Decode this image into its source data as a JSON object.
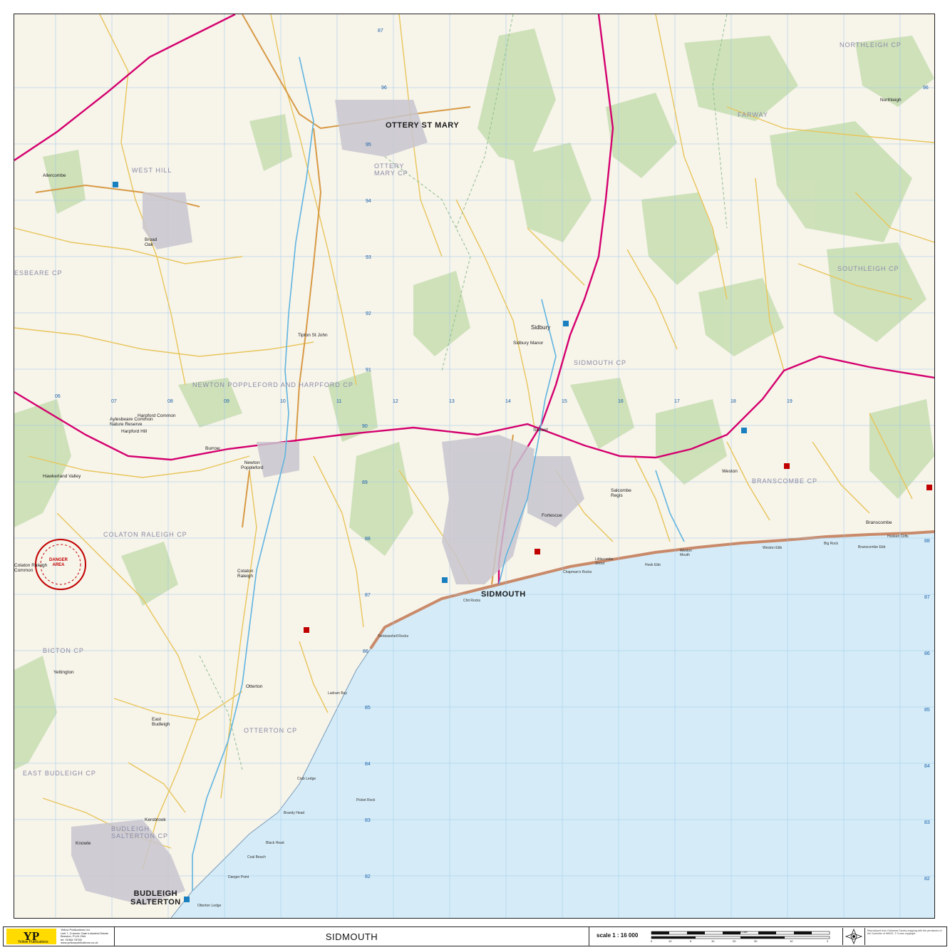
{
  "map": {
    "title": "SIDMOUTH",
    "scale": "scale  1 : 16 000",
    "colors": {
      "sea": "#d5ecf8",
      "land": "#f7f4ea",
      "woodland": "#c9dfb4",
      "a_road": "#d4006e",
      "b_road": "#e8b77a",
      "minor_road": "#f5e06a",
      "river": "#5fb4e0",
      "cliff": "#c98a6a",
      "grid": "#7fb5e0",
      "danger": "#c00000"
    },
    "towns": [
      {
        "id": "sidmouth",
        "name": "SIDMOUTH"
      },
      {
        "id": "ottery",
        "name": "OTTERY ST MARY"
      },
      {
        "id": "budleigh",
        "name": "BUDLEIGH\nSALTERTON"
      }
    ],
    "villages": [
      {
        "id": "sidbury",
        "name": "Sidbury"
      },
      {
        "id": "sidford",
        "name": "Sidford"
      },
      {
        "id": "newton",
        "name": "Newton\nPoppleford"
      },
      {
        "id": "colaton",
        "name": "Colaton\nRaleigh"
      },
      {
        "id": "otterton",
        "name": "Otterton"
      },
      {
        "id": "east-budleigh",
        "name": "East\nBudleigh"
      },
      {
        "id": "tipton",
        "name": "Tipton St John"
      },
      {
        "id": "harpford",
        "name": "Harpford Hill"
      },
      {
        "id": "weston",
        "name": "Weston"
      },
      {
        "id": "branscombe",
        "name": "Branscombe"
      },
      {
        "id": "salcombe",
        "name": "Salcombe\nRegis"
      },
      {
        "id": "northleigh",
        "name": "Northleigh"
      },
      {
        "id": "yettington",
        "name": "Yettington"
      },
      {
        "id": "knowle",
        "name": "Knowle"
      },
      {
        "id": "broad-oak",
        "name": "Broad\nOak"
      },
      {
        "id": "allercombe",
        "name": "Allercombe"
      },
      {
        "id": "hawkerland",
        "name": "Hawkerland Valley"
      },
      {
        "id": "fortescue",
        "name": "Fortescue"
      },
      {
        "id": "kersbrook",
        "name": "Kersbrook"
      },
      {
        "id": "aylesbeare-common",
        "name": "Aylesbeare Common\nNature Reserve"
      },
      {
        "id": "harpford-common",
        "name": "Harpford Common"
      },
      {
        "id": "sidbury-manor",
        "name": "Sidbury Manor"
      },
      {
        "id": "burrow",
        "name": "Burrow"
      },
      {
        "id": "colaton-common",
        "name": "Colaton Raleigh\nCommon"
      },
      {
        "id": "yettington-2",
        "name": "Yettington"
      }
    ],
    "parishes": [
      {
        "id": "p-ottery",
        "name": "OTTERY\nMARY CP"
      },
      {
        "id": "p-westhill",
        "name": "WEST HILL"
      },
      {
        "id": "p-northleigh",
        "name": "NORTHLEIGH CP"
      },
      {
        "id": "p-farway",
        "name": "FARWAY"
      },
      {
        "id": "p-southleigh",
        "name": "SOUTHLEIGH CP"
      },
      {
        "id": "p-aylesbeare",
        "name": "ESBEARE CP"
      },
      {
        "id": "p-newton",
        "name": "NEWTON POPPLEFORD AND HARPFORD CP"
      },
      {
        "id": "p-sidmouth",
        "name": "SIDMOUTH CP"
      },
      {
        "id": "p-branscombe",
        "name": "BRANSCOMBE CP"
      },
      {
        "id": "p-colaton",
        "name": "COLATON RALEIGH CP"
      },
      {
        "id": "p-bicton",
        "name": "BICTON CP"
      },
      {
        "id": "p-otterton",
        "name": "OTTERTON CP"
      },
      {
        "id": "p-eastbudleigh",
        "name": "EAST BUDLEIGH CP"
      },
      {
        "id": "p-budleigh",
        "name": "BUDLEIGH\nSALTERTON CP"
      }
    ],
    "coastal": [
      {
        "id": "c-ladram",
        "name": "Ladram Bay"
      },
      {
        "id": "c-chit",
        "name": "Chit Rocks"
      },
      {
        "id": "c-chapman",
        "name": "Chapman's Rocks"
      },
      {
        "id": "c-hook",
        "name": "Hook Ebb"
      },
      {
        "id": "c-littlecombe",
        "name": "Littlecombe\nShoot"
      },
      {
        "id": "c-weston-mouth",
        "name": "Weston\nMouth"
      },
      {
        "id": "c-weston-ebb",
        "name": "Weston Ebb"
      },
      {
        "id": "c-big-rock",
        "name": "Big Rock"
      },
      {
        "id": "c-branscombe-ebb",
        "name": "Branscombe Ebb"
      },
      {
        "id": "c-hooken",
        "name": "Hooken Cliffs"
      },
      {
        "id": "c-twist",
        "name": "Tortoiseshell Rocks"
      },
      {
        "id": "c-danger",
        "name": "Danger Point"
      },
      {
        "id": "c-black",
        "name": "Black Head"
      },
      {
        "id": "c-coal",
        "name": "Coal Beach"
      },
      {
        "id": "c-brandy",
        "name": "Brandy Head"
      },
      {
        "id": "c-crab",
        "name": "Crab Ledge"
      },
      {
        "id": "c-picket",
        "name": "Picket Rock"
      },
      {
        "id": "c-otter",
        "name": "Otterton Ledge"
      }
    ],
    "danger_area": "DANGER\nAREA",
    "grid_top": [
      "87",
      "96"
    ],
    "grid_right": [
      "96",
      "88",
      "87",
      "86",
      "85",
      "84",
      "83",
      "82"
    ],
    "grid_inner": [
      "95",
      "94",
      "93",
      "92",
      "91",
      "90",
      "89",
      "88",
      "87",
      "86",
      "85",
      "84",
      "83",
      "82"
    ],
    "grid_east_row": [
      "06",
      "07",
      "08",
      "09",
      "10",
      "11",
      "12",
      "13",
      "14",
      "15",
      "16",
      "17",
      "18",
      "19"
    ]
  },
  "footer": {
    "logo": "YP",
    "logo_sub": "Yellow Publications",
    "publisher_lines": "Yellow Publications Ltd\nUnit 7, Culverin Gate Industrial Estate\nBeeston, PL24 2NA\ntel: 01566 78765\nwww.yellowpublications.co.uk",
    "scale_numbers": [
      "0",
      "10",
      "5",
      "10",
      "20",
      "30",
      "1 mile",
      "10",
      "2"
    ],
    "copyright": "Reproduced from Ordnance Survey mapping with the permission of the Controller of HMSO. © Crown copyright."
  }
}
